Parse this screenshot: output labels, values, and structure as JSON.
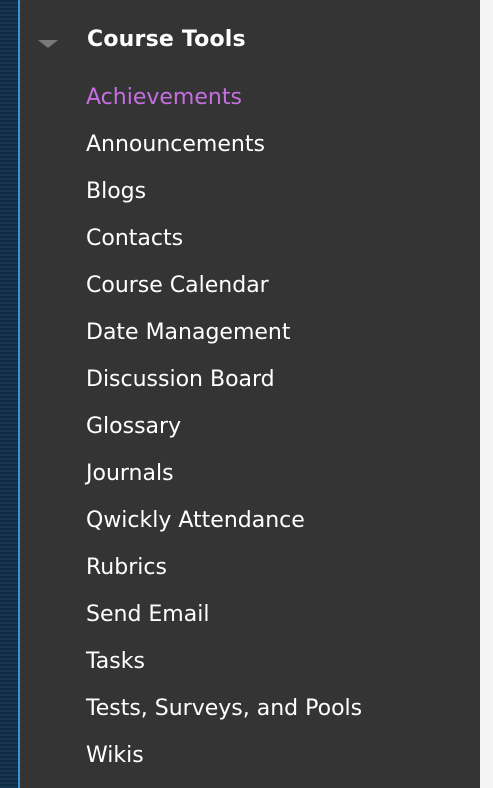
{
  "course_tools": {
    "title": "Course Tools",
    "items": [
      {
        "label": "Achievements"
      },
      {
        "label": "Announcements"
      },
      {
        "label": "Blogs"
      },
      {
        "label": "Contacts"
      },
      {
        "label": "Course Calendar"
      },
      {
        "label": "Date Management"
      },
      {
        "label": "Discussion Board"
      },
      {
        "label": "Glossary"
      },
      {
        "label": "Journals"
      },
      {
        "label": "Qwickly Attendance"
      },
      {
        "label": "Rubrics"
      },
      {
        "label": "Send Email"
      },
      {
        "label": "Tasks"
      },
      {
        "label": "Tests, Surveys, and Pools"
      },
      {
        "label": "Wikis"
      }
    ],
    "active_item": "Achievements",
    "colors": {
      "panel_bg": "#343434",
      "text": "#ffffff",
      "active_text": "#c66fe0",
      "caret": "#7a7a7a"
    }
  }
}
